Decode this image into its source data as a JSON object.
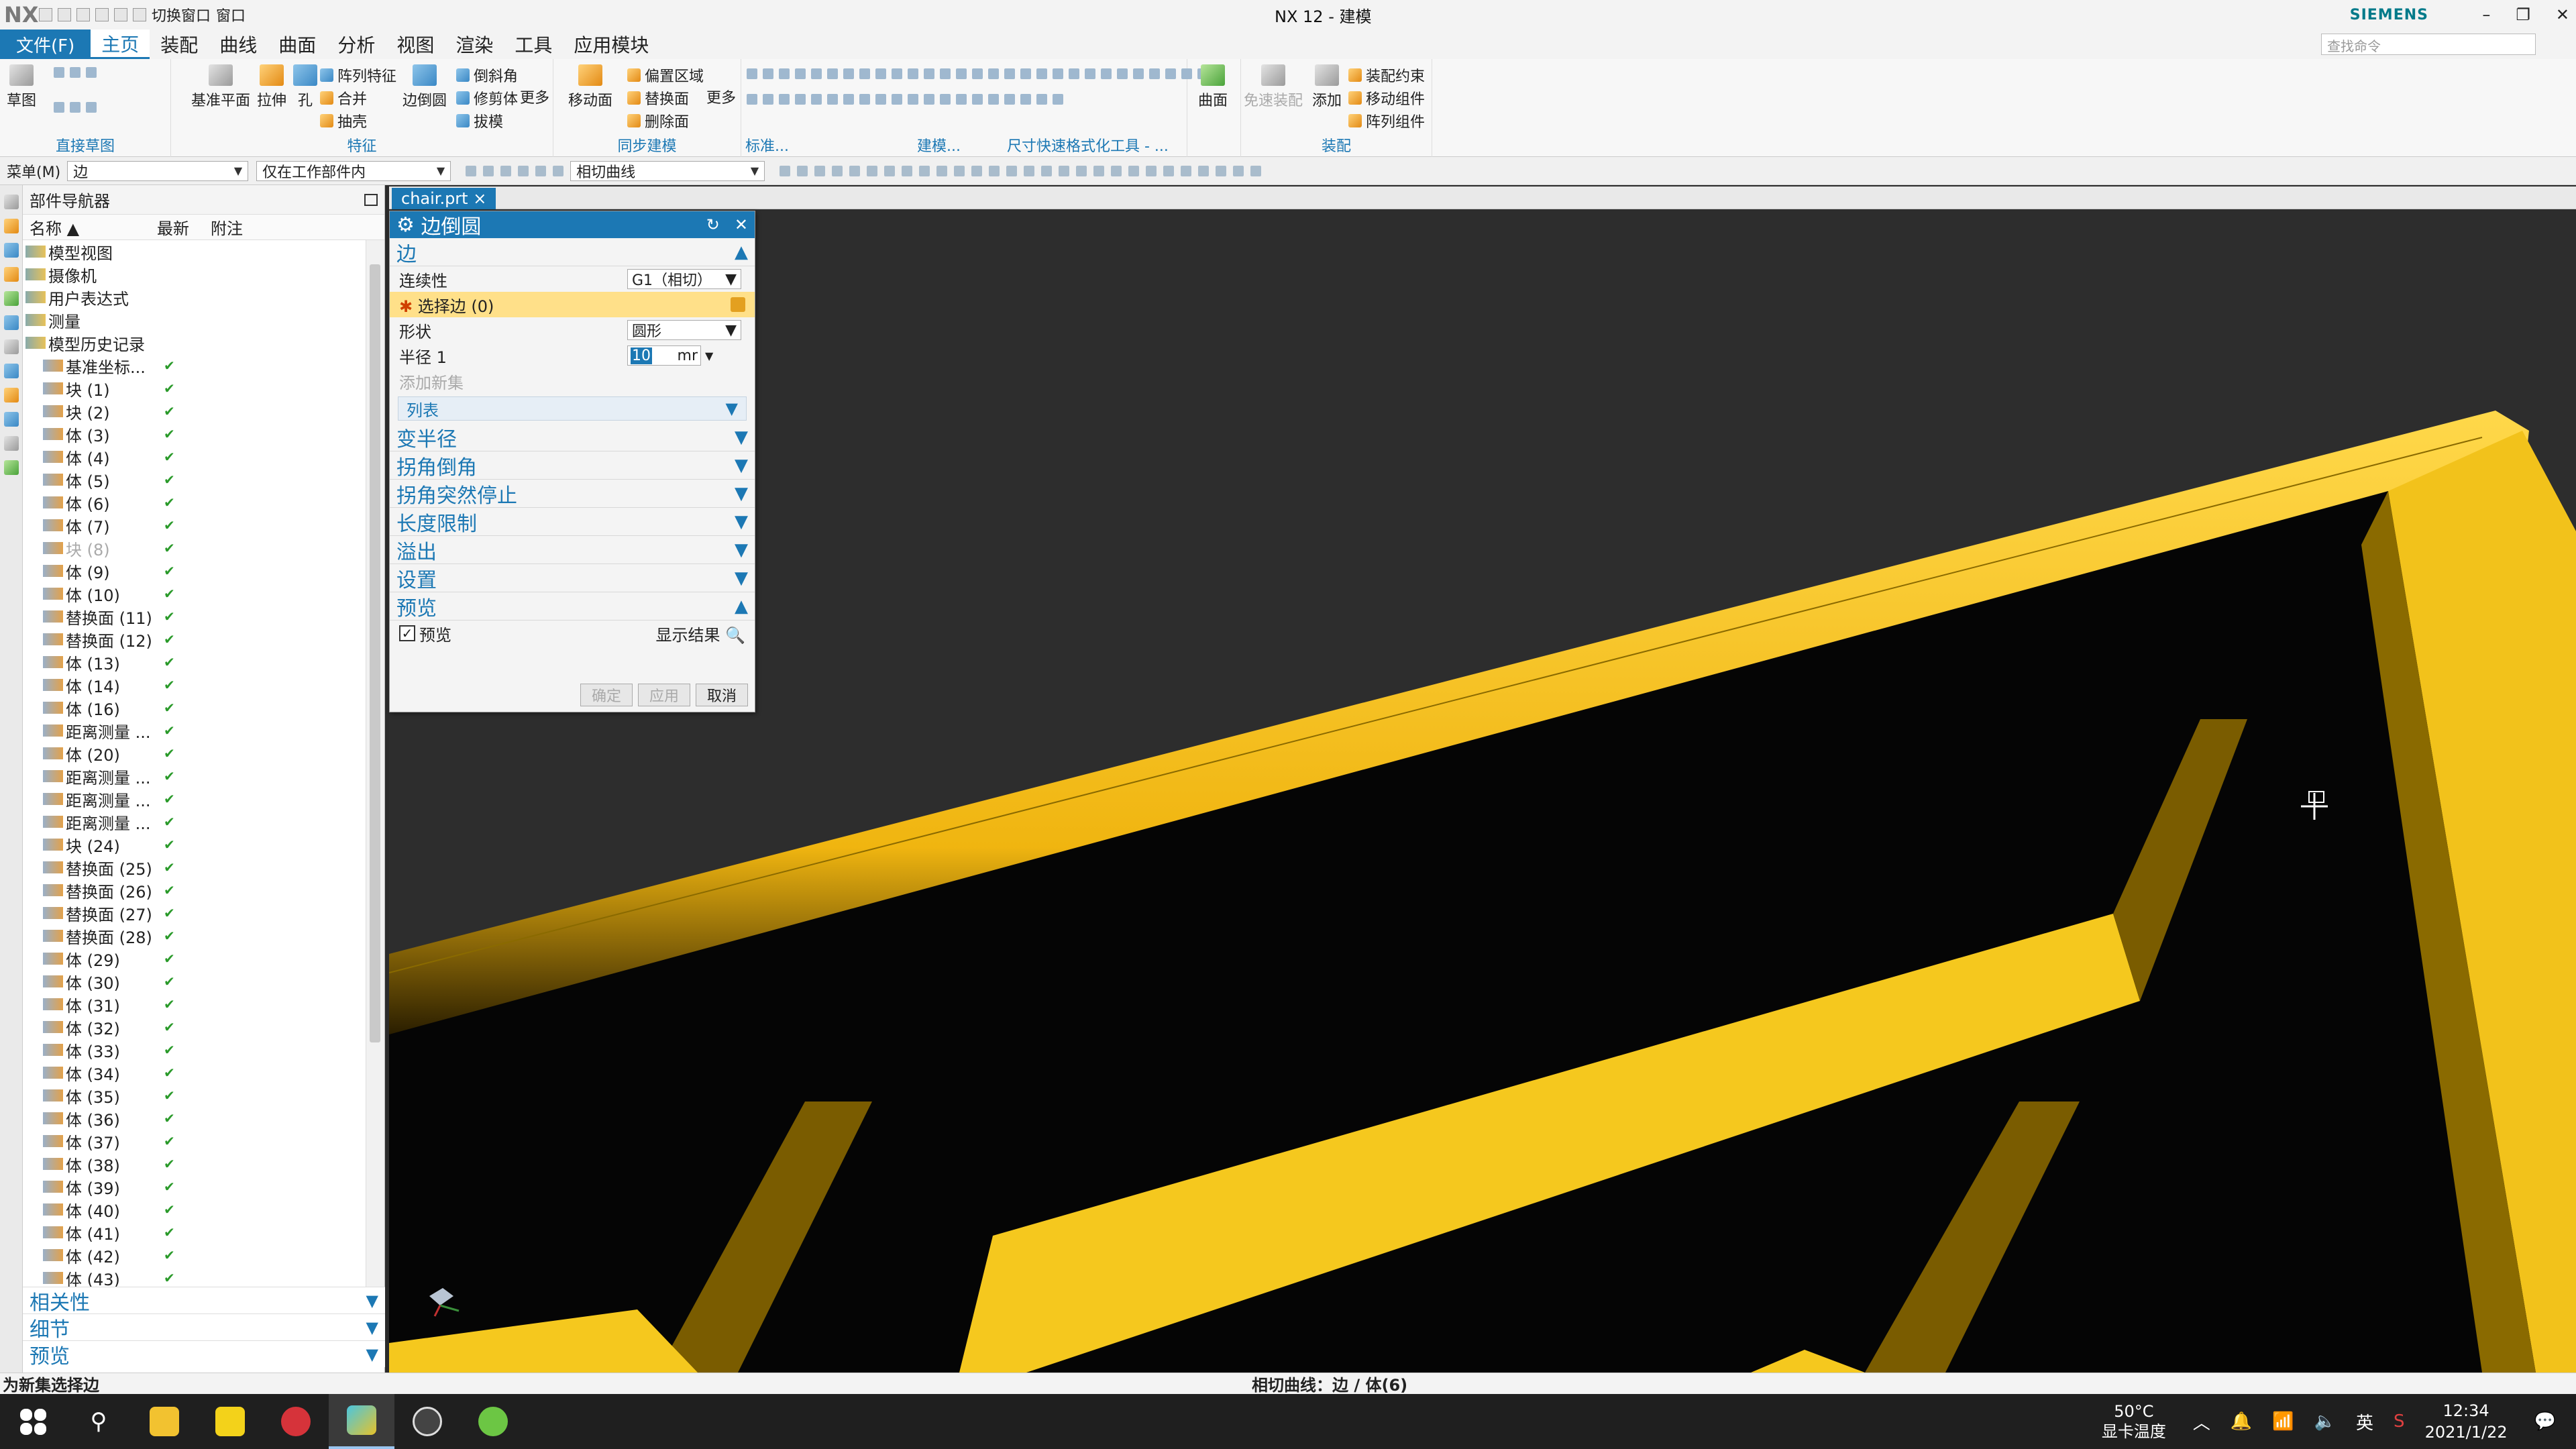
{
  "titlebar": {
    "logo": "NX",
    "quick_switch": "切换窗口",
    "quick_window": "窗口",
    "title": "NX 12 - 建模",
    "brand": "SIEMENS",
    "min": "–",
    "restore": "❐",
    "close": "✕"
  },
  "menubar": {
    "file": "文件(F)",
    "tabs": [
      "主页",
      "装配",
      "曲线",
      "曲面",
      "分析",
      "视图",
      "渲染",
      "工具",
      "应用模块"
    ],
    "search_placeholder": "查找命令"
  },
  "ribbon": {
    "sketch": "草图",
    "direct_sketch": "直接草图",
    "datum_plane": "基准平面",
    "extrude": "拉伸",
    "hole": "孔",
    "pattern_feature": "阵列特征",
    "unite": "合并",
    "shell": "抽壳",
    "edge_blend": "边倒圆",
    "chamfer": "倒斜角",
    "trim_body": "修剪体",
    "draft": "拔模",
    "more": "更多",
    "feature": "特征",
    "move_face": "移动面",
    "offset_region": "偏置区域",
    "replace_face": "替换面",
    "delete_face": "删除面",
    "more2": "更多",
    "sync_modeling": "同步建模",
    "standard": "标准...",
    "modeling": "建模...",
    "dim_quick_format": "尺寸快速格式化工具 - ...",
    "surface": "曲面",
    "free_assembly": "免速装配",
    "add": "添加",
    "assembly_constraint": "装配约束",
    "move_component": "移动组件",
    "pattern_component": "阵列组件",
    "assembly": "装配"
  },
  "selbar": {
    "menu": "菜单(M)",
    "filter": "边",
    "scope": "仅在工作部件内",
    "curve_rule": "相切曲线"
  },
  "navigator": {
    "title": "部件导航器",
    "col_name": "名称",
    "col_latest": "最新",
    "col_note": "附注",
    "items": [
      {
        "label": "模型视图",
        "lvl": 0,
        "check": ""
      },
      {
        "label": "摄像机",
        "lvl": 0,
        "check": ""
      },
      {
        "label": "用户表达式",
        "lvl": 0,
        "check": ""
      },
      {
        "label": "测量",
        "lvl": 0,
        "check": ""
      },
      {
        "label": "模型历史记录",
        "lvl": 0,
        "check": ""
      },
      {
        "label": "基准坐标...",
        "lvl": 1,
        "check": "✔"
      },
      {
        "label": "块 (1)",
        "lvl": 1,
        "check": "✔"
      },
      {
        "label": "块 (2)",
        "lvl": 1,
        "check": "✔"
      },
      {
        "label": "体 (3)",
        "lvl": 1,
        "check": "✔"
      },
      {
        "label": "体 (4)",
        "lvl": 1,
        "check": "✔"
      },
      {
        "label": "体 (5)",
        "lvl": 1,
        "check": "✔"
      },
      {
        "label": "体 (6)",
        "lvl": 1,
        "check": "✔"
      },
      {
        "label": "体 (7)",
        "lvl": 1,
        "check": "✔"
      },
      {
        "label": "块 (8)",
        "lvl": 1,
        "check": "✔",
        "muted": true
      },
      {
        "label": "体 (9)",
        "lvl": 1,
        "check": "✔"
      },
      {
        "label": "体 (10)",
        "lvl": 1,
        "check": "✔"
      },
      {
        "label": "替换面 (11)",
        "lvl": 1,
        "check": "✔"
      },
      {
        "label": "替换面 (12)",
        "lvl": 1,
        "check": "✔"
      },
      {
        "label": "体 (13)",
        "lvl": 1,
        "check": "✔"
      },
      {
        "label": "体 (14)",
        "lvl": 1,
        "check": "✔"
      },
      {
        "label": "体 (16)",
        "lvl": 1,
        "check": "✔"
      },
      {
        "label": "距离测量 ...",
        "lvl": 1,
        "check": "✔"
      },
      {
        "label": "体 (20)",
        "lvl": 1,
        "check": "✔"
      },
      {
        "label": "距离测量 ...",
        "lvl": 1,
        "check": "✔"
      },
      {
        "label": "距离测量 ...",
        "lvl": 1,
        "check": "✔"
      },
      {
        "label": "距离测量 ...",
        "lvl": 1,
        "check": "✔"
      },
      {
        "label": "块 (24)",
        "lvl": 1,
        "check": "✔"
      },
      {
        "label": "替换面 (25)",
        "lvl": 1,
        "check": "✔"
      },
      {
        "label": "替换面 (26)",
        "lvl": 1,
        "check": "✔"
      },
      {
        "label": "替换面 (27)",
        "lvl": 1,
        "check": "✔"
      },
      {
        "label": "替换面 (28)",
        "lvl": 1,
        "check": "✔"
      },
      {
        "label": "体 (29)",
        "lvl": 1,
        "check": "✔"
      },
      {
        "label": "体 (30)",
        "lvl": 1,
        "check": "✔"
      },
      {
        "label": "体 (31)",
        "lvl": 1,
        "check": "✔"
      },
      {
        "label": "体 (32)",
        "lvl": 1,
        "check": "✔"
      },
      {
        "label": "体 (33)",
        "lvl": 1,
        "check": "✔"
      },
      {
        "label": "体 (34)",
        "lvl": 1,
        "check": "✔"
      },
      {
        "label": "体 (35)",
        "lvl": 1,
        "check": "✔"
      },
      {
        "label": "体 (36)",
        "lvl": 1,
        "check": "✔"
      },
      {
        "label": "体 (37)",
        "lvl": 1,
        "check": "✔"
      },
      {
        "label": "体 (38)",
        "lvl": 1,
        "check": "✔"
      },
      {
        "label": "体 (39)",
        "lvl": 1,
        "check": "✔"
      },
      {
        "label": "体 (40)",
        "lvl": 1,
        "check": "✔"
      },
      {
        "label": "体 (41)",
        "lvl": 1,
        "check": "✔"
      },
      {
        "label": "体 (42)",
        "lvl": 1,
        "check": "✔"
      },
      {
        "label": "体 (43)",
        "lvl": 1,
        "check": "✔"
      }
    ],
    "sections": [
      "相关性",
      "细节",
      "预览"
    ]
  },
  "doc_tab": "chair.prt",
  "dialog": {
    "title": "边倒圆",
    "sec_edge": "边",
    "continuity_label": "连续性",
    "continuity_value": "G1（相切）",
    "select_edge": "选择边 (0)",
    "shape_label": "形状",
    "shape_value": "圆形",
    "radius_label": "半径 1",
    "radius_value": "10",
    "radius_unit": "mr",
    "add_new_set": "添加新集",
    "list": "列表",
    "sections": [
      "变半径",
      "拐角倒角",
      "拐角突然停止",
      "长度限制",
      "溢出",
      "设置"
    ],
    "sec_preview": "预览",
    "preview_check": "预览",
    "show_result": "显示结果",
    "ok": "确定",
    "apply": "应用",
    "cancel": "取消"
  },
  "statusbar": {
    "left": "为新集选择边",
    "mid": "相切曲线：边 / 体(6)"
  },
  "taskbar": {
    "temp": "50°C",
    "temp_label": "显卡温度",
    "ime": "英",
    "time": "12:34",
    "date": "2021/1/22"
  },
  "colors": {
    "accent": "#1c78b4",
    "model_yellow": "#f5c518",
    "viewport_bg": "#2d2d2d"
  }
}
